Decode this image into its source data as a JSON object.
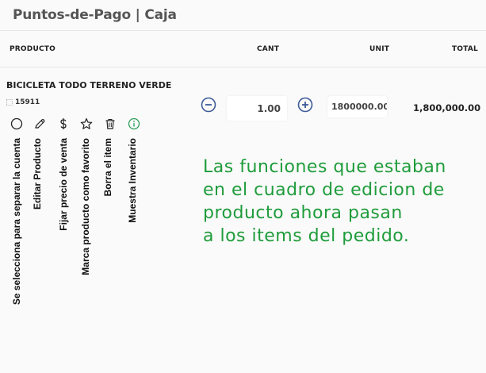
{
  "header": {
    "title": "Puntos-de-Pago | Caja"
  },
  "columns": {
    "product": "PRODUCTO",
    "qty": "CANT",
    "unit": "UNIT",
    "total": "TOTAL"
  },
  "item": {
    "name": "BICICLETA TODO TERRENO VERDE",
    "sku": "15911",
    "qty": "1.00",
    "unit_price": "1800000.00",
    "total": "1,800,000.00"
  },
  "actions": [
    {
      "icon": "circle-icon",
      "label": "Se selecciona para separar la cuenta"
    },
    {
      "icon": "pencil-icon",
      "label": "Editar Producto"
    },
    {
      "icon": "dollar-icon",
      "label": "Fijar precio de venta"
    },
    {
      "icon": "star-icon",
      "label": "Marca producto como favorito"
    },
    {
      "icon": "trash-icon",
      "label": "Borra el item"
    },
    {
      "icon": "info-icon",
      "label": "Muestra Inventario"
    }
  ],
  "annotation": {
    "lines": [
      "Las funciones que estaban",
      "en el cuadro de edicion de",
      "producto ahora pasan",
      "a los items del pedido."
    ]
  },
  "colors": {
    "accent_blue": "#3d5a99",
    "note_green": "#1f9c3b",
    "info_green": "#2e9e5a"
  }
}
